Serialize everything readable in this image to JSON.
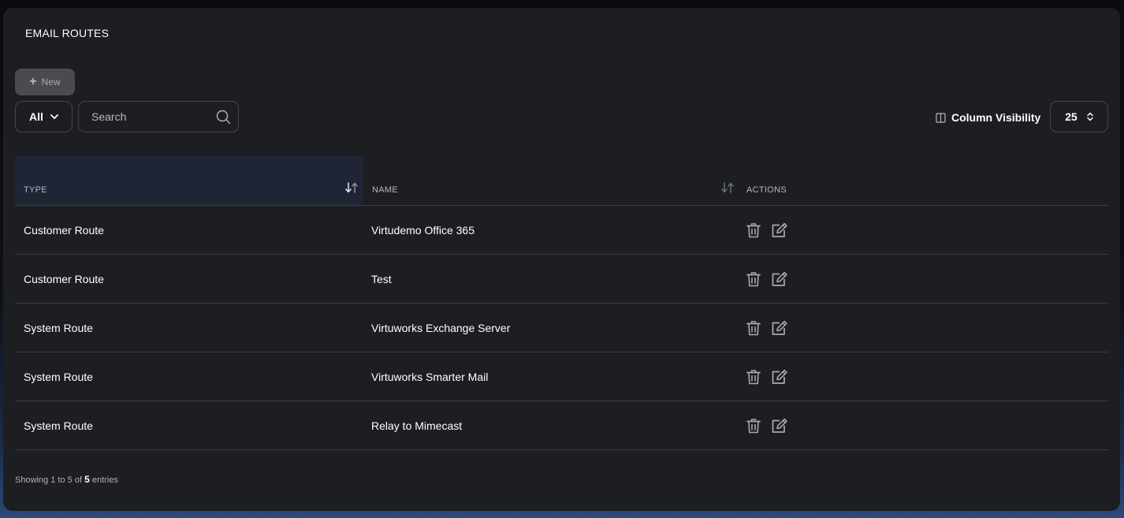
{
  "panel": {
    "title": "EMAIL ROUTES"
  },
  "toolbar": {
    "new_label": "New",
    "filter_value": "All",
    "search_placeholder": "Search",
    "column_visibility_label": "Column Visibility",
    "page_size": "25"
  },
  "table": {
    "columns": {
      "type": "TYPE",
      "name": "NAME",
      "actions": "ACTIONS"
    },
    "rows": [
      {
        "type": "Customer Route",
        "name": "Virtudemo Office 365"
      },
      {
        "type": "Customer Route",
        "name": "Test"
      },
      {
        "type": "System Route",
        "name": "Virtuworks Exchange Server"
      },
      {
        "type": "System Route",
        "name": "Virtuworks Smarter Mail"
      },
      {
        "type": "System Route",
        "name": "Relay to Mimecast"
      }
    ]
  },
  "footer": {
    "prefix": "Showing 1 to 5 of",
    "total": "5",
    "suffix": "entries"
  },
  "colors": {
    "panel_bg": "#1d1e22",
    "sorted_header_bg": "#1f2534",
    "border": "#3a3c42",
    "icon": "#a8aab0"
  },
  "icons": [
    "plus-icon",
    "chevron-down-icon",
    "search-icon",
    "columns-icon",
    "updown-icon",
    "sort-icon",
    "trash-icon",
    "edit-icon"
  ]
}
